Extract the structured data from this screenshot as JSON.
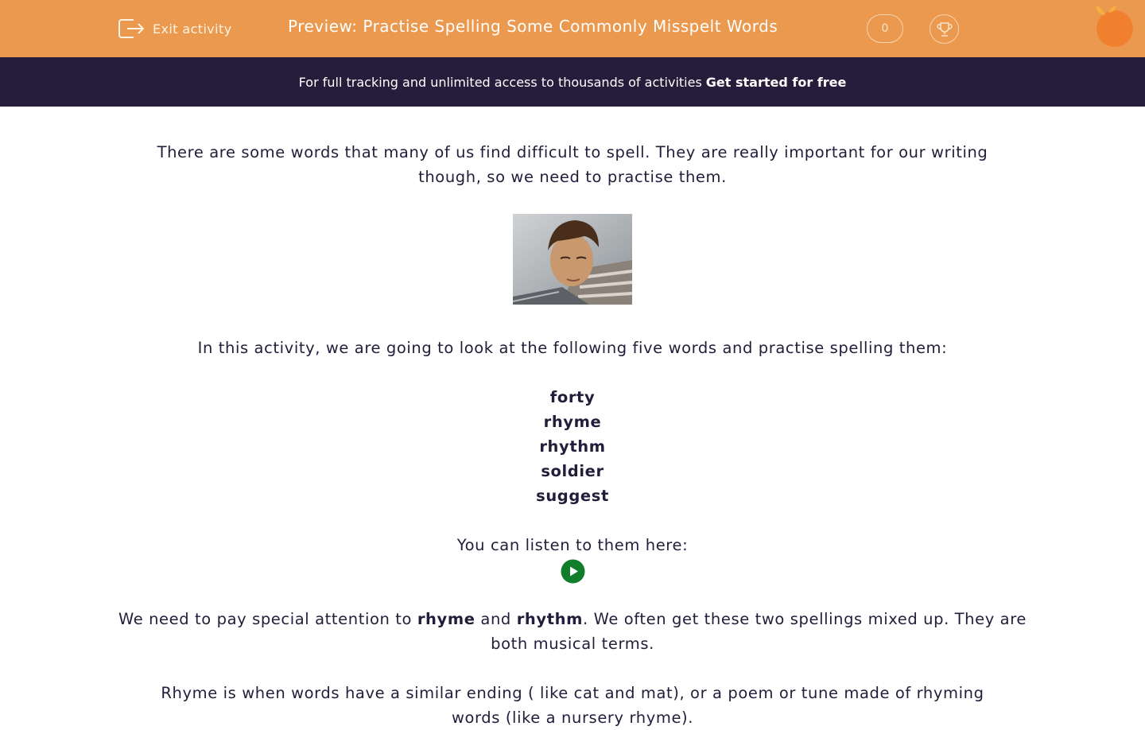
{
  "header": {
    "exit_label": "Exit activity",
    "title": "Preview: Practise Spelling Some Commonly Misspelt Words",
    "score": "0",
    "icons": {
      "exit": "exit-door-icon",
      "trophy": "trophy-icon",
      "logo": "orange-logo-icon"
    }
  },
  "promo": {
    "text": "For full tracking and unlimited access to thousands of activities",
    "cta": "Get started for free"
  },
  "content": {
    "intro": "There are some words that many of us find difficult to spell.  They are really important for our writing though, so we need to practise them.",
    "image_subject": "boy looking at a laptop screen",
    "lead": "In this activity, we are going to look at the following five words and practise spelling them:",
    "words": [
      "forty",
      "rhyme",
      "rhythm",
      "soldier",
      "suggest"
    ],
    "listen": "You can listen to them here:",
    "attention": {
      "part1": "We need to pay special attention to ",
      "word1": "rhyme",
      "part2": " and ",
      "word2": "rhythm",
      "part3": ".  We often get these two spellings mixed up.  They are both musical terms."
    },
    "rhyme_def": "Rhyme is when words have a similar ending ( like cat and mat), or a poem or tune made of rhyming words (like a nursery rhyme)."
  },
  "colors": {
    "header": "#ea994e",
    "promo": "#251d3b",
    "text": "#231c3a",
    "play": "#0f7d2a"
  }
}
